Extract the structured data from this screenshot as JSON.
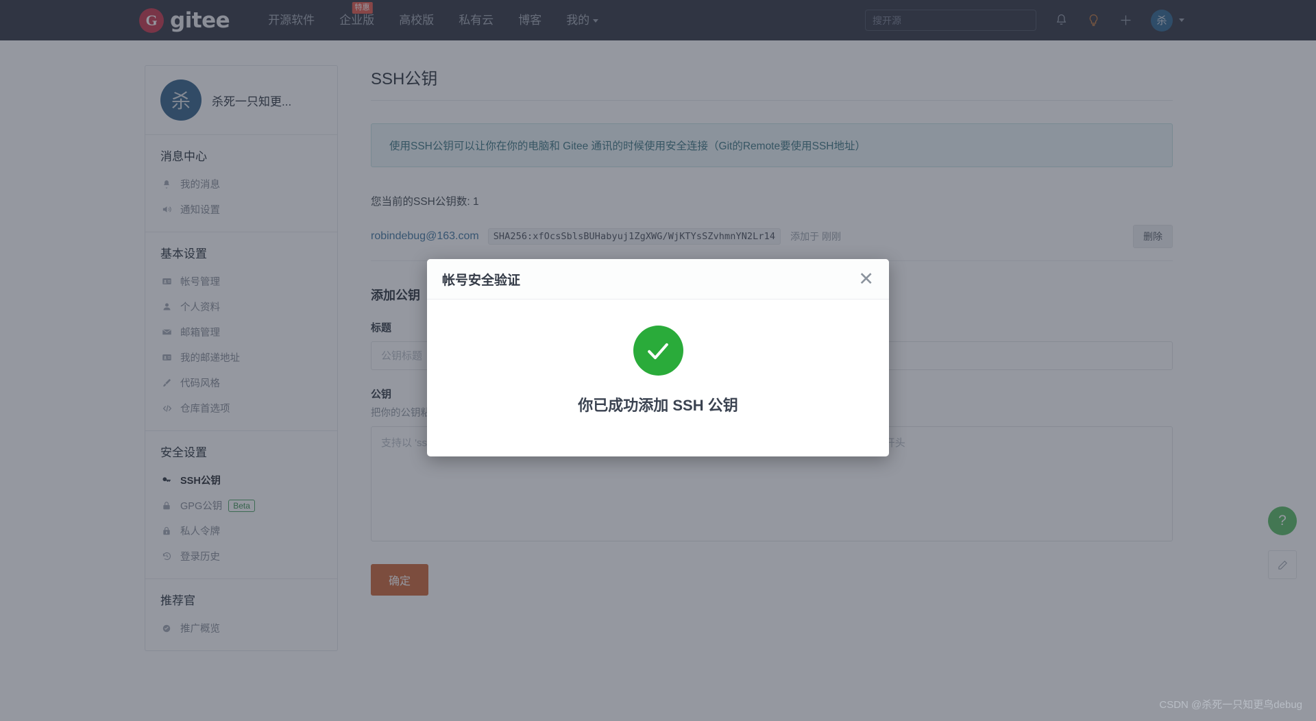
{
  "header": {
    "logo_letter": "G",
    "logo_text": "gitee",
    "nav": [
      {
        "label": "开源软件",
        "badge": ""
      },
      {
        "label": "企业版",
        "badge": "特惠"
      },
      {
        "label": "高校版",
        "badge": ""
      },
      {
        "label": "私有云",
        "badge": ""
      },
      {
        "label": "博客",
        "badge": ""
      },
      {
        "label": "我的",
        "badge": "",
        "caret": true
      }
    ],
    "search_placeholder": "搜开源",
    "icons": [
      "bell-icon",
      "lightbulb-icon",
      "plus-icon"
    ],
    "avatar_letter": "杀"
  },
  "sidebar": {
    "profile": {
      "avatar_letter": "杀",
      "name": "杀死一只知更..."
    },
    "groups": [
      {
        "title": "消息中心",
        "items": [
          {
            "label": "我的消息",
            "icon": "bell-icon",
            "glyph": "🔔",
            "active": false
          },
          {
            "label": "通知设置",
            "icon": "speaker-icon",
            "glyph": "🔊",
            "active": false
          }
        ]
      },
      {
        "title": "基本设置",
        "items": [
          {
            "label": "帐号管理",
            "icon": "id-card-icon",
            "glyph": "📇",
            "active": false
          },
          {
            "label": "个人资料",
            "icon": "user-icon",
            "glyph": "👤",
            "active": false
          },
          {
            "label": "邮箱管理",
            "icon": "envelope-icon",
            "glyph": "✉",
            "active": false
          },
          {
            "label": "我的邮递地址",
            "icon": "address-card-icon",
            "glyph": "📇",
            "active": false
          },
          {
            "label": "代码风格",
            "icon": "brush-icon",
            "glyph": "🖌",
            "active": false
          },
          {
            "label": "仓库首选项",
            "icon": "code-icon",
            "glyph": "</>",
            "active": false
          }
        ]
      },
      {
        "title": "安全设置",
        "items": [
          {
            "label": "SSH公钥",
            "icon": "key-icon",
            "glyph": "🔑",
            "active": true
          },
          {
            "label": "GPG公钥",
            "icon": "lock-icon",
            "glyph": "🔒",
            "active": false,
            "tag": "Beta"
          },
          {
            "label": "私人令牌",
            "icon": "token-icon",
            "glyph": "🔒",
            "active": false
          },
          {
            "label": "登录历史",
            "icon": "history-icon",
            "glyph": "↺",
            "active": false
          }
        ]
      },
      {
        "title": "推荐官",
        "items": [
          {
            "label": "推广概览",
            "icon": "promo-icon",
            "glyph": "◔",
            "active": false
          }
        ]
      }
    ]
  },
  "main": {
    "title": "SSH公钥",
    "notice": "使用SSH公钥可以让你在你的电脑和 Gitee 通讯的时候使用安全连接（Git的Remote要使用SSH地址）",
    "key_count_text": "您当前的SSH公钥数: 1",
    "key_row": {
      "email": "robindebug@163.com",
      "fingerprint": "SHA256:xfOcsSblsBUHabyuj1ZgXWG/WjKTYsSZvhmnYN2Lr14",
      "added_time": "添加于 刚刚",
      "delete_label": "删除"
    },
    "add_section_title": "添加公钥",
    "title_field": {
      "label": "标题",
      "placeholder": "公钥标题"
    },
    "key_field": {
      "label": "公钥",
      "help": "把你的公钥粘贴到这里",
      "placeholder": "支持以 'ssh-rsa', 'ssh-dss', 'ssh-ed25519', 'ecdsa-sha2-nistp256', 'ecdsa-sha2-nistp384', 'ecdsa-sha2-nistp521' 开头"
    },
    "submit_label": "确定"
  },
  "modal": {
    "title": "帐号安全验证",
    "close_glyph": "✕",
    "message": "你已成功添加 SSH 公钥",
    "success_color": "#2aab3a"
  },
  "floating": {
    "help_glyph": "?",
    "feedback_glyph": "✎"
  },
  "watermark": "CSDN @杀死一只知更鸟debug",
  "colors": {
    "header_bg": "#1f2532",
    "accent": "#c75a27",
    "brand_red": "#c0243a",
    "link_blue": "#2f6a97"
  }
}
